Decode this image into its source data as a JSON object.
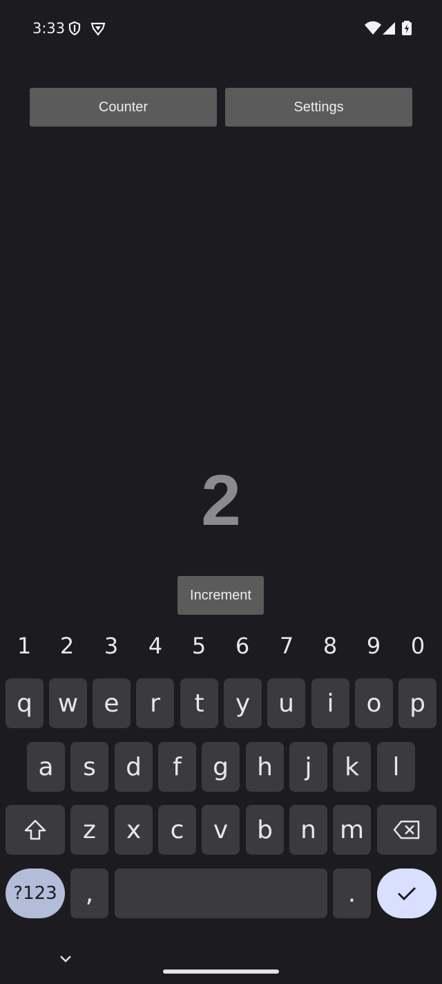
{
  "status_bar": {
    "time": "3:33",
    "left_icons": [
      "shield-icon",
      "vpn-shield-icon"
    ],
    "right_icons": [
      "wifi-icon",
      "signal-icon",
      "battery-icon"
    ]
  },
  "tabs": [
    {
      "label": "Counter"
    },
    {
      "label": "Settings"
    }
  ],
  "counter": {
    "value": "2",
    "increment_label": "Increment"
  },
  "keyboard": {
    "number_row": [
      "1",
      "2",
      "3",
      "4",
      "5",
      "6",
      "7",
      "8",
      "9",
      "0"
    ],
    "row1": [
      "q",
      "w",
      "e",
      "r",
      "t",
      "y",
      "u",
      "i",
      "o",
      "p"
    ],
    "row2": [
      "a",
      "s",
      "d",
      "f",
      "g",
      "h",
      "j",
      "k",
      "l"
    ],
    "row3": [
      "z",
      "x",
      "c",
      "v",
      "b",
      "n",
      "m"
    ],
    "symbols_label": "?123",
    "comma": ",",
    "period": ".",
    "icons": {
      "shift": "shift-icon",
      "backspace": "backspace-icon",
      "enter": "checkmark-icon"
    }
  },
  "colors": {
    "background": "#1c1b1f",
    "button": "#5b5b5c",
    "key": "#3b3b3f",
    "symbols_key": "#b3bcd9",
    "enter_key": "#d9e0ff"
  }
}
